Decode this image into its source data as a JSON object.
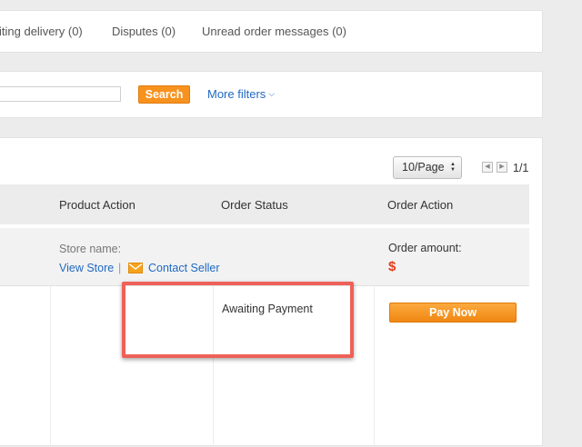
{
  "tabs": [
    {
      "label": "iting delivery (0)"
    },
    {
      "label": "Disputes (0)"
    },
    {
      "label": "Unread order messages (0)"
    }
  ],
  "search": {
    "button_label": "Search",
    "more_filters_label": "More filters",
    "more_filters_icon": "chevron-down-icon"
  },
  "pagination": {
    "page_size": "10/Page",
    "page_info": "1/1"
  },
  "table": {
    "columns": [
      "Product Action",
      "Order Status",
      "Order Action"
    ]
  },
  "store": {
    "label": "Store name:",
    "view_store_link": "View Store",
    "separator": "|",
    "contact_icon": "envelope-icon",
    "contact_link": "Contact Seller"
  },
  "order": {
    "amount_label": "Order amount:",
    "amount_value": "$",
    "status": "Awaiting Payment",
    "pay_button_label": "Pay Now"
  },
  "colors": {
    "accent_orange": "#f7921e",
    "link_blue": "#1f69c2",
    "price_red": "#e53b1b",
    "highlight_red": "#ee6158"
  }
}
